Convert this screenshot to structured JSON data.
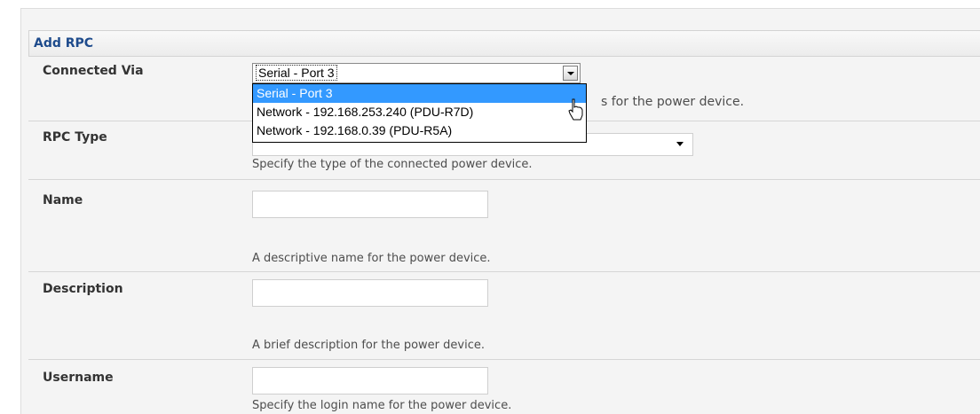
{
  "panel": {
    "title": "Add RPC"
  },
  "connected_via": {
    "label": "Connected Via",
    "selected": "Serial - Port 3",
    "options": [
      "Serial - Port 3",
      "Network - 192.168.253.240 (PDU-R7D)",
      "Network - 192.168.0.39 (PDU-R5A)"
    ],
    "help_visible_fragment": "s for the power device."
  },
  "rpc_type": {
    "label": "RPC Type",
    "help": "Specify the type of the connected power device."
  },
  "name": {
    "label": "Name",
    "value": "",
    "help": "A descriptive name for the power device."
  },
  "description": {
    "label": "Description",
    "value": "",
    "help": "A brief description for the power device."
  },
  "username": {
    "label": "Username",
    "value": "",
    "help": "Specify the login name for the power device."
  },
  "colors": {
    "header_text": "#1e4b8c",
    "selection": "#3399ff"
  }
}
